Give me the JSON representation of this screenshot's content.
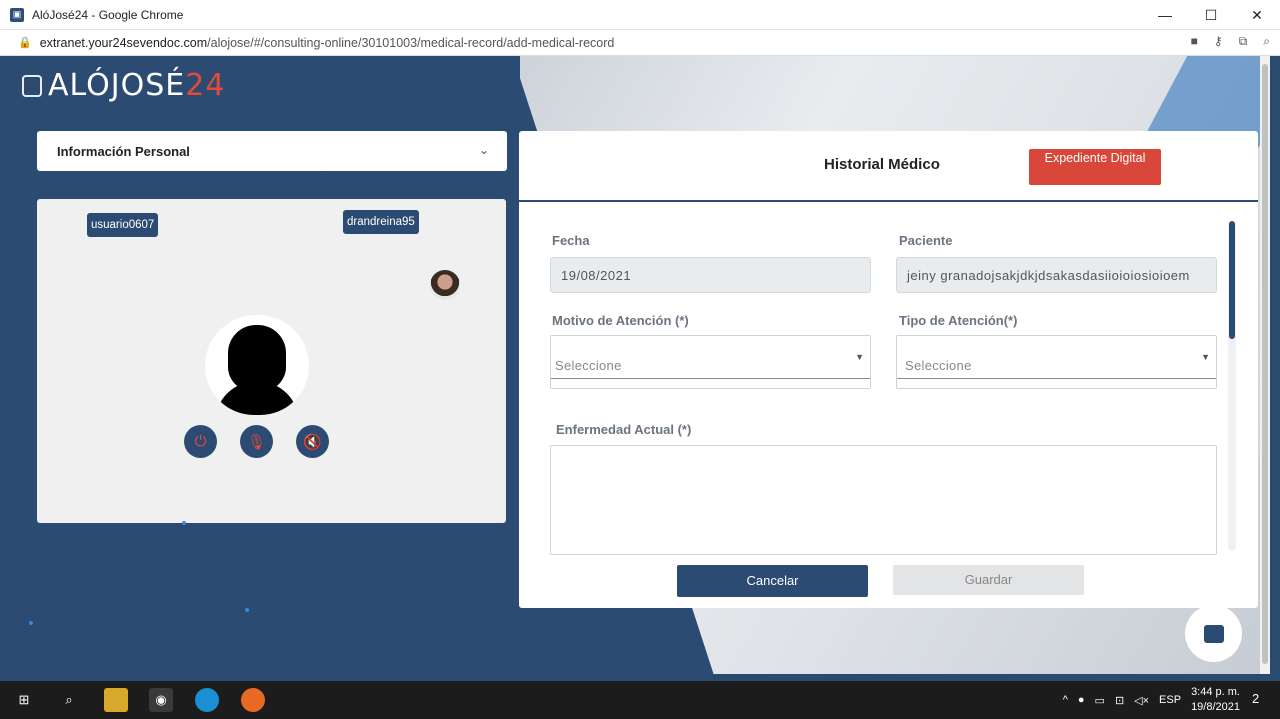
{
  "browser": {
    "window_title": "AlóJosé24 - Google Chrome",
    "url_host": "extranet.your24sevendoc.com",
    "url_path": "/alojose/#/consulting-online/30101003/medical-record/add-medical-record"
  },
  "logo": {
    "text": "ALÓJOSÉ",
    "number": "24"
  },
  "info_card": {
    "label": "Información Personal"
  },
  "video": {
    "local_user": "usuario0607",
    "remote_user": "drandreina95"
  },
  "panel": {
    "title": "Historial Médico",
    "expediente_label": "Expediente Digital",
    "fecha_label": "Fecha",
    "fecha_value": "19/08/2021",
    "paciente_label": "Paciente",
    "paciente_value": "jeiny granadojsakjdkjdsakasdasiioioiosioioem",
    "motivo_label": "Motivo de Atención (*)",
    "motivo_placeholder": "Seleccione",
    "tipo_label": "Tipo de Atención(*)",
    "tipo_placeholder": "Seleccione",
    "enfermedad_label": "Enfermedad Actual (*)",
    "cancel_label": "Cancelar",
    "save_label": "Guardar"
  },
  "taskbar": {
    "lang": "ESP",
    "time": "3:44 p. m.",
    "date": "19/8/2021",
    "notifications": "2"
  },
  "colors": {
    "brand": "#2b4b72",
    "accent": "#d9473a"
  }
}
